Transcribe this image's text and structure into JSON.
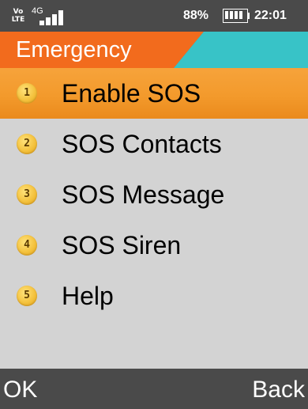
{
  "status": {
    "volte_top": "Vo",
    "volte_bottom": "LTE",
    "network": "4G",
    "battery_percent": "88%",
    "battery_level": 0.88,
    "time": "22:01"
  },
  "title": "Emergency",
  "colors": {
    "title_accent": "#f26b1d",
    "title_secondary": "#38c3c7",
    "selection": "#f39a2c",
    "menu_background": "#d3d3d3",
    "bars": "#4a4a4a"
  },
  "menu": {
    "items": [
      {
        "number": "1",
        "label": "Enable SOS",
        "selected": true
      },
      {
        "number": "2",
        "label": "SOS Contacts",
        "selected": false
      },
      {
        "number": "3",
        "label": "SOS Message",
        "selected": false
      },
      {
        "number": "4",
        "label": "SOS Siren",
        "selected": false
      },
      {
        "number": "5",
        "label": "Help",
        "selected": false
      }
    ]
  },
  "softkeys": {
    "left": "OK",
    "right": "Back"
  },
  "icons": {
    "volte": "volte-icon",
    "signal": "signal-strength-icon",
    "battery": "battery-icon"
  }
}
